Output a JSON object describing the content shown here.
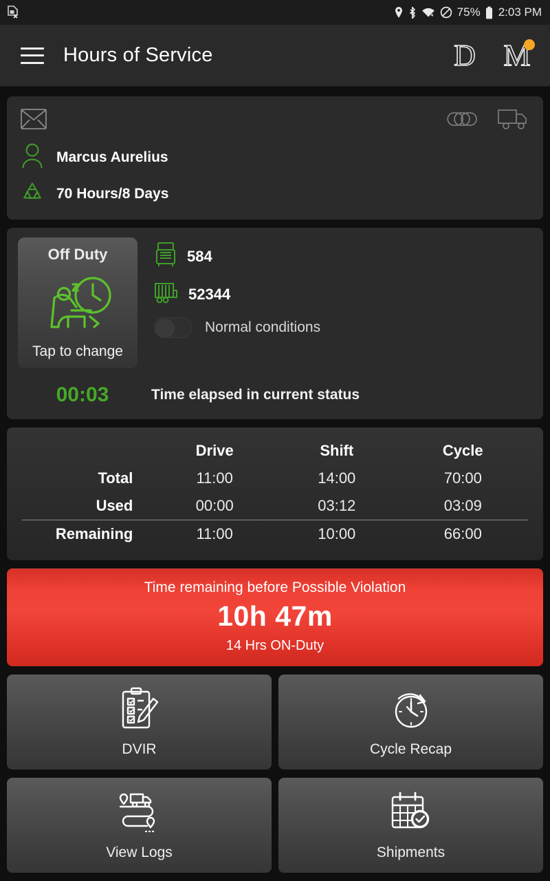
{
  "statusbar": {
    "left_icon": "sim-card-off-icon",
    "icons": [
      "location-pin-icon",
      "bluetooth-icon",
      "wifi-icon",
      "do-not-disturb-icon"
    ],
    "battery_percent": "75%",
    "battery_icon": "battery-icon",
    "time": "2:03 PM"
  },
  "toolbar": {
    "menu_icon": "hamburger-menu-icon",
    "title": "Hours of Service",
    "diagnostic_letter": "D",
    "malfunction_letter": "M",
    "malfunction_badge": true
  },
  "driver_card": {
    "mail_icon": "envelope-icon",
    "link_icon": "chain-link-icon",
    "truck_icon": "truck-icon",
    "driver_icon": "driver-person-icon",
    "driver_name": "Marcus Aurelius",
    "cycle_icon": "recycle-cycle-icon",
    "cycle_rule": "70 Hours/8 Days"
  },
  "status_card": {
    "duty_status": "Off Duty",
    "duty_icon": "off-duty-sleeping-clock-icon",
    "tap_hint": "Tap to change",
    "tractor_icon": "tractor-icon",
    "tractor_number": "584",
    "trailer_icon": "trailer-icon",
    "trailer_number": "52344",
    "conditions_toggle_state": "off",
    "conditions_label": "Normal conditions",
    "elapsed_time": "00:03",
    "elapsed_label": "Time elapsed in current status"
  },
  "hours_table": {
    "columns": [
      "",
      "Drive",
      "Shift",
      "Cycle"
    ],
    "rows": [
      {
        "label": "Total",
        "values": [
          "11:00",
          "14:00",
          "70:00"
        ]
      },
      {
        "label": "Used",
        "values": [
          "00:00",
          "03:12",
          "03:09"
        ]
      },
      {
        "label": "Remaining",
        "values": [
          "11:00",
          "10:00",
          "66:00"
        ]
      }
    ]
  },
  "violation": {
    "title": "Time remaining before Possible Violation",
    "time": "10h 47m",
    "subtitle": "14 Hrs ON-Duty",
    "color": "#ef4136"
  },
  "tiles": [
    {
      "label": "DVIR",
      "icon": "clipboard-checklist-pencil-icon"
    },
    {
      "label": "Cycle Recap",
      "icon": "clock-recap-icon"
    },
    {
      "label": "View Logs",
      "icon": "route-truck-pins-icon"
    },
    {
      "label": "Shipments",
      "icon": "calendar-check-icon"
    }
  ],
  "partial_tile": {
    "icon": "officer-cap-icon"
  },
  "colors": {
    "accent_green": "#46a828",
    "background": "#0f0f0f",
    "card": "#2b2b2b",
    "toolbar": "#2a2a2a",
    "badge_orange": "#f5a623"
  }
}
